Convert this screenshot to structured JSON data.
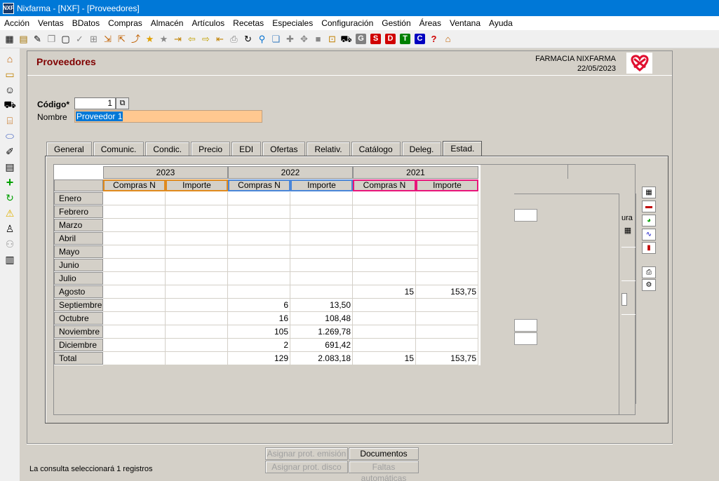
{
  "window": {
    "title": "Nixfarma - [NXF] - [Proveedores]",
    "app_icon_text": "NXF"
  },
  "menu": [
    "Acción",
    "Ventas",
    "BDatos",
    "Compras",
    "Almacén",
    "Artículos",
    "Recetas",
    "Especiales",
    "Configuración",
    "Gestión",
    "Áreas",
    "Ventana",
    "Ayuda"
  ],
  "toolbar": {
    "box_buttons": [
      {
        "label": "G",
        "color": "#808080"
      },
      {
        "label": "S",
        "color": "#d00000"
      },
      {
        "label": "D",
        "color": "#d00000"
      },
      {
        "label": "T",
        "color": "#008000"
      },
      {
        "label": "C",
        "color": "#0000c0"
      }
    ],
    "help_label": "?"
  },
  "header": {
    "title": "Proveedores",
    "company": "FARMACIA NIXFARMA",
    "date": "22/05/2023"
  },
  "form": {
    "code_label": "Código*",
    "code_value": "1",
    "name_label": "Nombre",
    "name_value": "Proveedor 1"
  },
  "tabs": [
    "General",
    "Comunic.",
    "Condic.",
    "Precio",
    "EDI",
    "Ofertas",
    "Relativ.",
    "Catálogo",
    "Deleg.",
    "Estad."
  ],
  "active_tab": "Estad.",
  "grid": {
    "years": [
      {
        "year": "2023",
        "color": "#e08a1e"
      },
      {
        "year": "2022",
        "color": "#4a86d8"
      },
      {
        "year": "2021",
        "color": "#e8157a"
      }
    ],
    "subcols": [
      "Compras N",
      "Importe"
    ],
    "rows": [
      {
        "month": "Enero",
        "values": [
          "",
          "",
          "",
          "",
          "",
          ""
        ]
      },
      {
        "month": "Febrero",
        "values": [
          "",
          "",
          "",
          "",
          "",
          ""
        ]
      },
      {
        "month": "Marzo",
        "values": [
          "",
          "",
          "",
          "",
          "",
          ""
        ]
      },
      {
        "month": "Abril",
        "values": [
          "",
          "",
          "",
          "",
          "",
          ""
        ]
      },
      {
        "month": "Mayo",
        "values": [
          "",
          "",
          "",
          "",
          "",
          ""
        ]
      },
      {
        "month": "Junio",
        "values": [
          "",
          "",
          "",
          "",
          "",
          ""
        ]
      },
      {
        "month": "Julio",
        "values": [
          "",
          "",
          "",
          "",
          "",
          ""
        ]
      },
      {
        "month": "Agosto",
        "values": [
          "",
          "",
          "",
          "",
          "15",
          "153,75"
        ]
      },
      {
        "month": "Septiembre",
        "values": [
          "",
          "",
          "6",
          "13,50",
          "",
          ""
        ]
      },
      {
        "month": "Octubre",
        "values": [
          "",
          "",
          "16",
          "108,48",
          "",
          ""
        ]
      },
      {
        "month": "Noviembre",
        "values": [
          "",
          "",
          "105",
          "1.269,78",
          "",
          ""
        ]
      },
      {
        "month": "Diciembre",
        "values": [
          "",
          "",
          "2",
          "691,42",
          "",
          ""
        ]
      },
      {
        "month": "Total",
        "values": [
          "",
          "",
          "129",
          "2.083,18",
          "15",
          "153,75"
        ]
      }
    ]
  },
  "right_panel": {
    "partial_label": "ura"
  },
  "buttons": {
    "asignar_emision": "Asignar prot. emisión",
    "documentos": "Documentos",
    "asignar_disco": "Asignar prot. disco",
    "faltas": "Faltas automáticas"
  },
  "status": "La consulta seleccionará 1  registros"
}
